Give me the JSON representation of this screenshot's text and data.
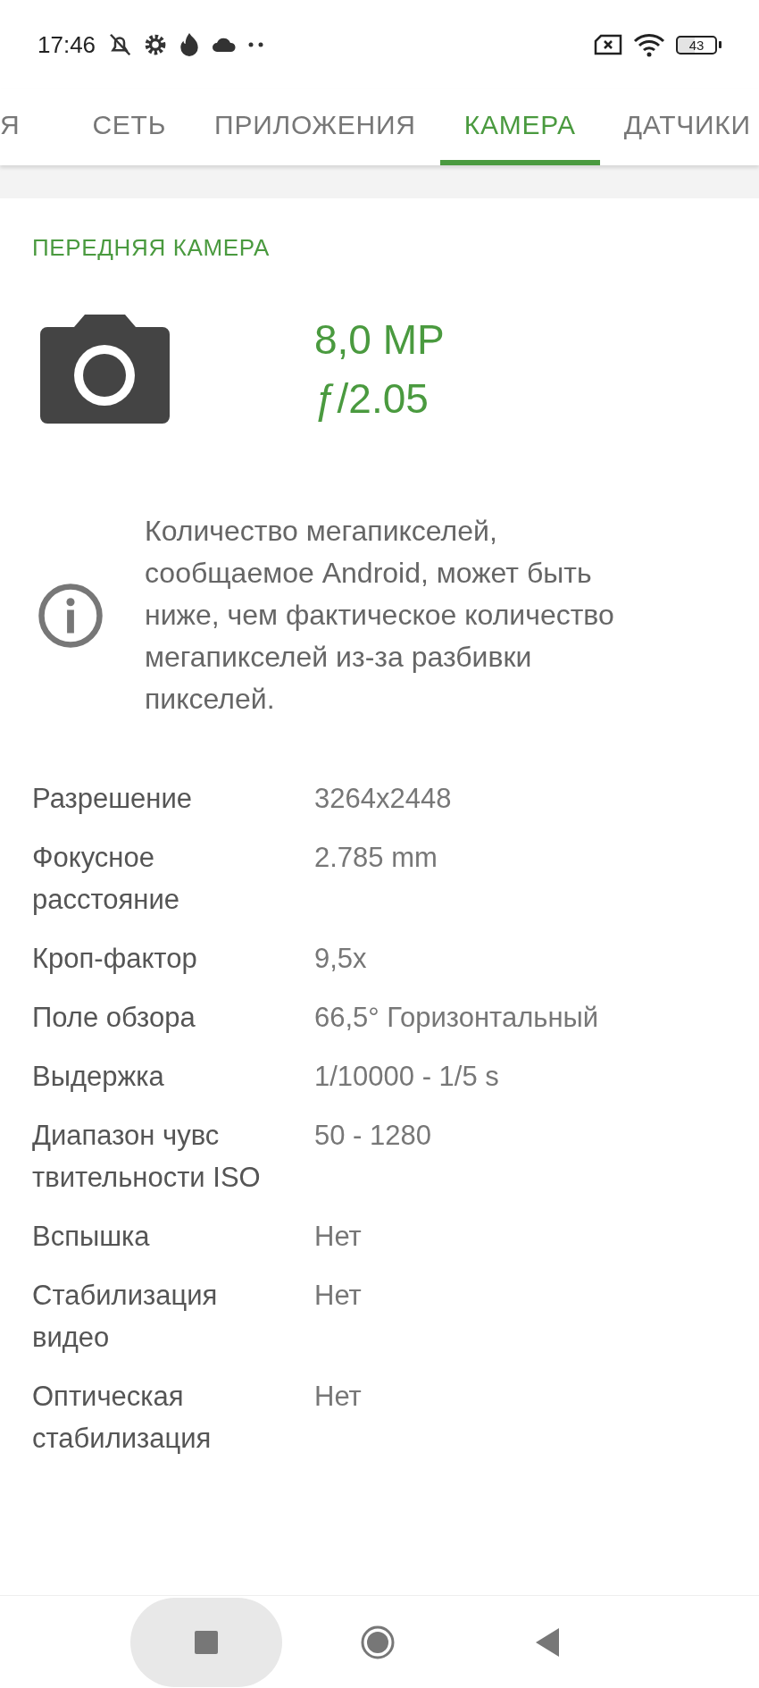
{
  "status_bar": {
    "time": "17:46",
    "battery": "43"
  },
  "tabs": [
    {
      "label": "Я",
      "selected": false
    },
    {
      "label": "СЕТЬ",
      "selected": false
    },
    {
      "label": "ПРИЛОЖЕНИЯ",
      "selected": false
    },
    {
      "label": "КАМЕРА",
      "selected": true
    },
    {
      "label": "ДАТЧИКИ",
      "selected": false
    }
  ],
  "section": {
    "title": "ПЕРЕДНЯЯ КАМЕРА",
    "megapixels": "8,0 MP",
    "aperture": "ƒ/2.05"
  },
  "note": "Количество мегапикселей, сообщаемое Android, может быть ниже, чем фактическое количество мегапикселей из-за разбивки пикселей.",
  "specs": [
    {
      "label": "Разрешение",
      "value": "3264x2448"
    },
    {
      "label": "Фокусное расстояние",
      "value": "2.785 mm"
    },
    {
      "label": "Кроп-фактор",
      "value": "9,5x"
    },
    {
      "label": "Поле обзора",
      "value": "66,5° Горизонтальный"
    },
    {
      "label": "Выдержка",
      "value": "1/10000 - 1/5 s"
    },
    {
      "label": "Диапазон чувс твительности ISO",
      "value": "50 - 1280"
    },
    {
      "label": "Вспышка",
      "value": "Нет"
    },
    {
      "label": "Стабилизация видео",
      "value": "Нет"
    },
    {
      "label": "Оптическая стабилизация",
      "value": "Нет"
    }
  ]
}
